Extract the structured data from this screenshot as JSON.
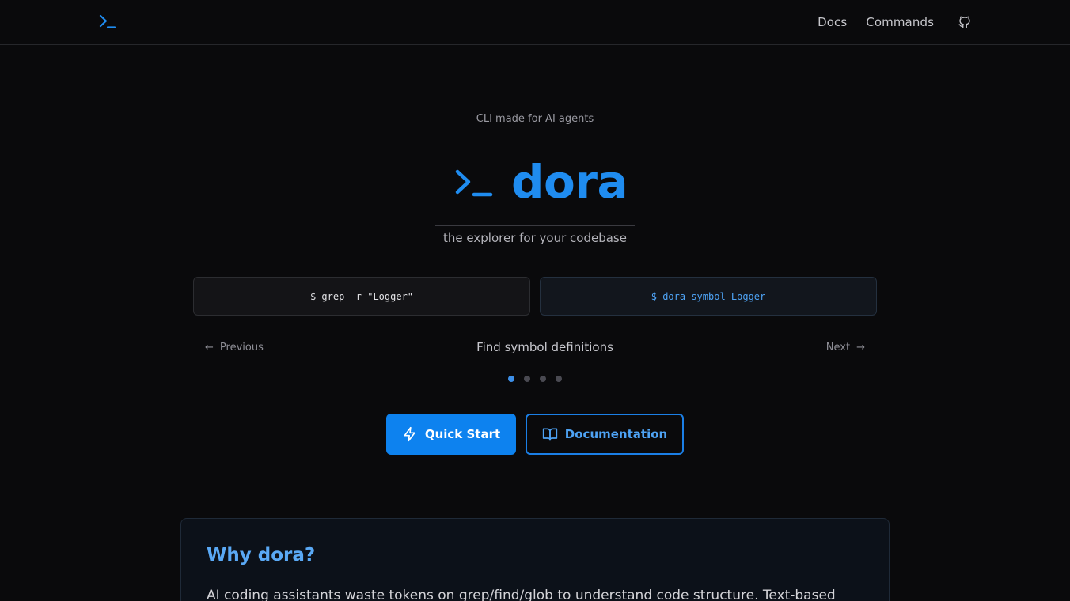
{
  "header": {
    "nav": [
      {
        "label": "Docs"
      },
      {
        "label": "Commands"
      }
    ]
  },
  "hero": {
    "tagline": "CLI made for AI agents",
    "title": "dora",
    "subtitle": "the explorer for your codebase"
  },
  "comparison": {
    "left_command": "$ grep -r \"Logger\"",
    "right_command": "$ dora symbol Logger"
  },
  "carousel": {
    "prev_label": "Previous",
    "next_label": "Next",
    "prev_arrow": "←",
    "next_arrow": "→",
    "current_title": "Find symbol definitions",
    "active_index": 0,
    "total": 4
  },
  "actions": {
    "quick_start_label": "Quick Start",
    "docs_label": "Documentation"
  },
  "why": {
    "title": "Why dora?",
    "text": "AI coding assistants waste tokens on grep/find/glob to understand code structure. Text-based"
  },
  "colors": {
    "accent": "#1f8cf0",
    "background": "#0a0a0c",
    "primary_button": "#0d82ef"
  },
  "icons": {
    "logo": "terminal-prompt-icon",
    "github": "github-icon",
    "quick_start": "bolt-icon",
    "docs": "book-open-icon"
  }
}
